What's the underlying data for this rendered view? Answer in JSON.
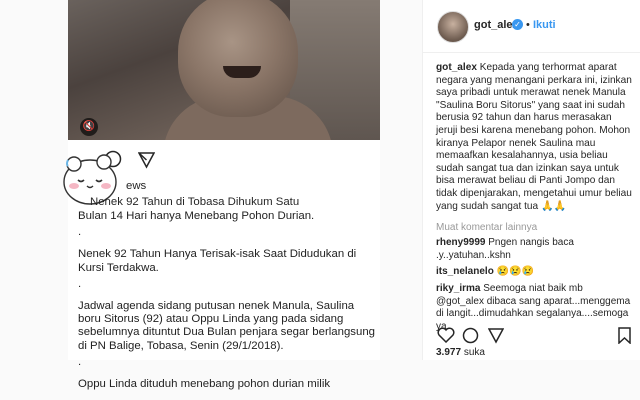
{
  "post": {
    "headline_fragment": "ews",
    "line1": "Nenek 92 Tahun di Tobasa Dihukum Satu",
    "line2": "Bulan 14 Hari hanya Menebang Pohon Durian.",
    "dot1": ".",
    "para2": "Nenek 92 Tahun Hanya Terisak-isak Saat Didudukan di Kursi Terdakwa.",
    "dot2": ".",
    "para3": "Jadwal agenda sidang putusan nenek Manula, Saulina boru Sitorus (92) atau Oppu Linda yang pada sidang sebelumnya dituntut Dua Bulan penjara segar berlangsung di PN Balige, Tobasa, Senin (29/1/2018).",
    "dot3": ".",
    "para4": "Oppu Linda dituduh menebang pohon durian milik"
  },
  "sidebar": {
    "username": "got_alex",
    "dot": "•",
    "follow_label": "Ikuti",
    "caption_user": "got_alex",
    "caption_text": "Kepada yang terhormat aparat negara yang menangani perkara ini, izinkan saya pribadi untuk merawat nenek Manula \"Saulina Boru Sitorus\" yang saat ini sudah berusia 92 tahun dan harus merasakan jeruji besi karena menebang pohon. Mohon kiranya Pelapor nenek Saulina mau memaafkan kesalahannya, usia beliau sudah sangat tua dan izinkan saya untuk bisa merawat beliau di Panti Jompo dan tidak dipenjarakan, mengetahui umur beliau yang sudah sangat tua 🙏🙏",
    "load_more": "Muat komentar lainnya",
    "comments": [
      {
        "user": "rheny9999",
        "text": "Pngen nangis baca .y..yatuhan..kshn"
      },
      {
        "user": "its_nelanelo",
        "text": "😢😢😢"
      },
      {
        "user": "riky_irma",
        "text": "Seemoga niat baik mb @got_alex dibaca sang aparat...menggema di langit...dimudahkan segalanya....semoga ya"
      }
    ],
    "likes_count": "3.977",
    "likes_label": "suka"
  },
  "colors": {
    "accent": "#3897f0",
    "muted": "#999999"
  },
  "icons": [
    "mute-icon",
    "comment-icon",
    "share-icon",
    "sticker-icon",
    "heart-icon",
    "bookmark-icon",
    "verified-icon"
  ]
}
